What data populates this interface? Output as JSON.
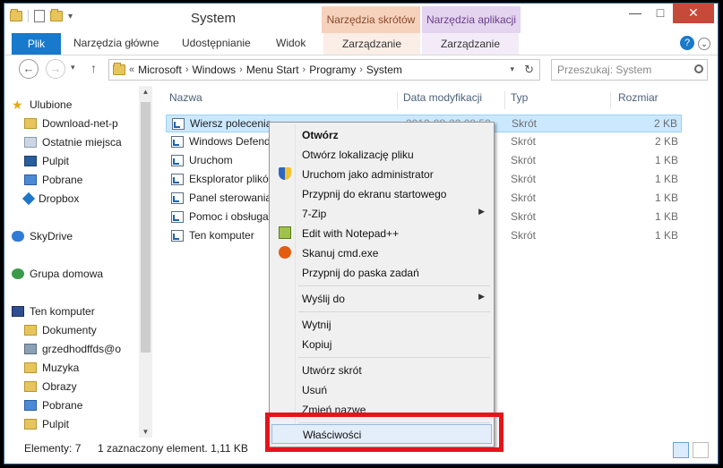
{
  "window": {
    "title": "System",
    "context_tab_1": "Narzędzia skrótów",
    "context_tab_2": "Narzędzia aplikacji",
    "min_btn": "—",
    "max_btn": "□",
    "close_btn": "✕"
  },
  "ribbon": {
    "file": "Plik",
    "tabs": [
      "Narzędzia główne",
      "Udostępnianie",
      "Widok"
    ],
    "ctx_a": "Zarządzanie",
    "ctx_b": "Zarządzanie",
    "help": "?"
  },
  "address": {
    "prefix": "«",
    "crumbs": [
      "Microsoft",
      "Windows",
      "Menu Start",
      "Programy",
      "System"
    ],
    "search_placeholder": "Przeszukaj: System"
  },
  "nav": {
    "favorites": "Ulubione",
    "fav_items": [
      "Download-net-p",
      "Ostatnie miejsca",
      "Pulpit",
      "Pobrane",
      "Dropbox"
    ],
    "skydrive": "SkyDrive",
    "homegroup": "Grupa domowa",
    "computer": "Ten komputer",
    "pc_items": [
      "Dokumenty",
      "grzedhodffds@o",
      "Muzyka",
      "Obrazy",
      "Pobrane",
      "Pulpit"
    ]
  },
  "columns": {
    "name": "Nazwa",
    "date": "Data modyfikacji",
    "type": "Typ",
    "size": "Rozmiar"
  },
  "files": [
    {
      "name": "Wiersz polecenia",
      "date": "2012-08-22 08:53",
      "type": "Skrót",
      "size": "2 KB"
    },
    {
      "name": "Windows Defender",
      "date": "",
      "type": "Skrót",
      "size": "2 KB"
    },
    {
      "name": "Uruchom",
      "date": "",
      "type": "Skrót",
      "size": "1 KB"
    },
    {
      "name": "Eksplorator plików",
      "date": "",
      "type": "Skrót",
      "size": "1 KB"
    },
    {
      "name": "Panel sterowania",
      "date": "",
      "type": "Skrót",
      "size": "1 KB"
    },
    {
      "name": "Pomoc i obsługa",
      "date": "",
      "type": "Skrót",
      "size": "1 KB"
    },
    {
      "name": "Ten komputer",
      "date": "",
      "type": "Skrót",
      "size": "1 KB"
    }
  ],
  "status": {
    "count": "Elementy: 7",
    "selection": "1 zaznaczony element. 1,11 KB"
  },
  "menu": {
    "open": "Otwórz",
    "open_location": "Otwórz lokalizację pliku",
    "run_admin": "Uruchom jako administrator",
    "pin_start": "Przypnij do ekranu startowego",
    "zip": "7-Zip",
    "notepad": "Edit with Notepad++",
    "scan": "Skanuj cmd.exe",
    "pin_taskbar": "Przypnij do paska zadań",
    "send_to": "Wyślij do",
    "cut": "Wytnij",
    "copy": "Kopiuj",
    "create_shortcut": "Utwórz skrót",
    "delete": "Usuń",
    "rename": "Zmień nazwę",
    "properties": "Właściwości"
  },
  "colors": {
    "accent": "#1979ca",
    "highlight_box": "#e5141b"
  }
}
